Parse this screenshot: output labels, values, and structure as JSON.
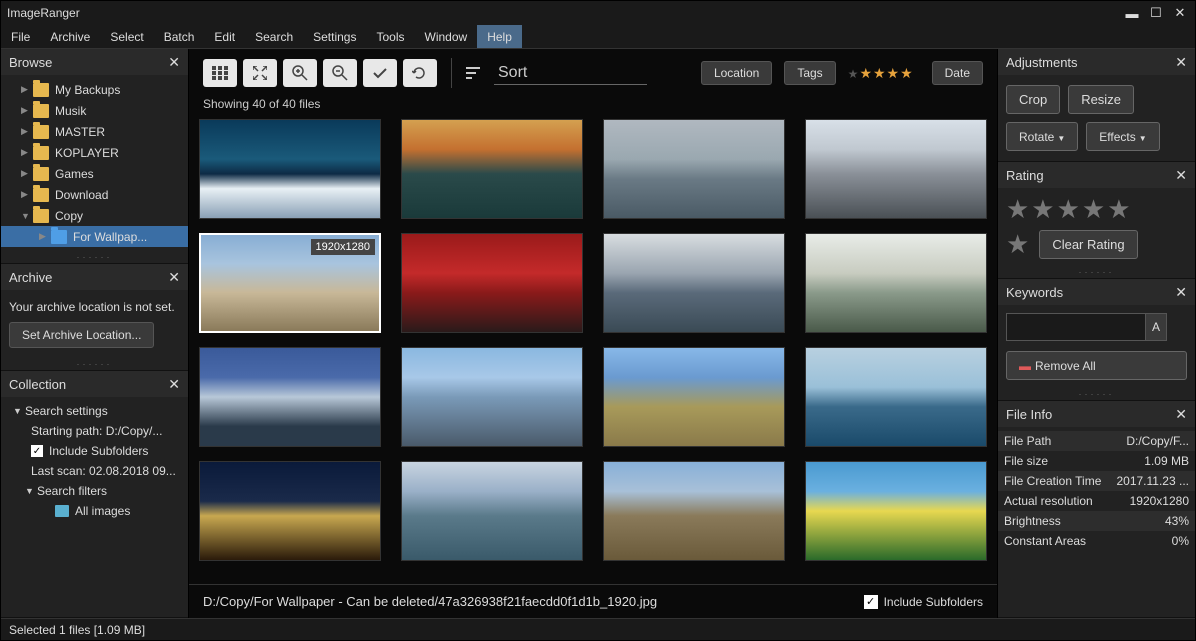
{
  "app_title": "ImageRanger",
  "menu": [
    "File",
    "Archive",
    "Select",
    "Batch",
    "Edit",
    "Search",
    "Settings",
    "Tools",
    "Window",
    "Help"
  ],
  "menu_hover_index": 9,
  "browse": {
    "title": "Browse",
    "items": [
      {
        "label": "My Backups",
        "expanded": false,
        "level": 1
      },
      {
        "label": "Musik",
        "expanded": false,
        "level": 1
      },
      {
        "label": "MASTER",
        "expanded": false,
        "level": 1
      },
      {
        "label": "KOPLAYER",
        "expanded": false,
        "level": 1
      },
      {
        "label": "Games",
        "expanded": false,
        "level": 1
      },
      {
        "label": "Download",
        "expanded": false,
        "level": 1
      },
      {
        "label": "Copy",
        "expanded": true,
        "level": 1
      },
      {
        "label": "For Wallpap...",
        "expanded": false,
        "level": 2,
        "selected": true
      }
    ]
  },
  "archive": {
    "title": "Archive",
    "msg": "Your archive location is not set.",
    "btn": "Set Archive Location..."
  },
  "collection": {
    "title": "Collection",
    "search_settings": "Search settings",
    "starting_path": "Starting path: D:/Copy/...",
    "include_subfolders": "Include Subfolders",
    "last_scan": "Last scan: 02.08.2018 09...",
    "search_filters": "Search filters",
    "all_images": "All images"
  },
  "toolbar": {
    "sort": "Sort",
    "location": "Location",
    "tags": "Tags",
    "date": "Date"
  },
  "showing": "Showing 40 of 40 files",
  "selected_badge": "1920x1280",
  "thumbs": [
    {
      "gradient": "linear-gradient(180deg,#0a3a5a 0%,#1a5a7a 40%,#0d2a45 55%,#e8f0f5 70%,#8aa0b5 100%)"
    },
    {
      "gradient": "linear-gradient(180deg,#d4a050 0%,#c47030 30%,#2a4a4a 55%,#1a3a3a 100%)"
    },
    {
      "gradient": "linear-gradient(180deg,#b0b8c0 0%,#9aa8b0 40%,#6a7a85 60%,#4a5a65 100%)"
    },
    {
      "gradient": "linear-gradient(180deg,#d8e0e8 0%,#c0c8d0 30%,#8a9098 55%,#4a5055 100%)"
    },
    {
      "gradient": "linear-gradient(180deg,#88aed4 0%,#a8c4de 30%,#c8b898 60%,#8a7a5a 100%)",
      "selected": true,
      "badge": true
    },
    {
      "gradient": "linear-gradient(180deg,#9a1a1a 0%,#c42a2a 40%,#8a1a1a 60%,#2a1a1a 100%)"
    },
    {
      "gradient": "linear-gradient(180deg,#d8dde0 0%,#9aa5b0 40%,#5a6a7a 60%,#3a4a55 100%)"
    },
    {
      "gradient": "linear-gradient(180deg,#e8ece8 0%,#c8ccc0 40%,#8a9a8a 60%,#4a5a4a 100%)"
    },
    {
      "gradient": "linear-gradient(180deg,#3a5a9a 0%,#4a6aaa 30%,#b8c8d8 50%,#2a3a4a 80%)"
    },
    {
      "gradient": "linear-gradient(180deg,#8ab8e0 0%,#a8c8e8 30%,#7a9ab8 50%,#4a5a6a 100%)"
    },
    {
      "gradient": "linear-gradient(180deg,#88b8e8 0%,#6a9ad0 30%,#a89a5a 60%,#8a7a4a 100%)"
    },
    {
      "gradient": "linear-gradient(180deg,#b8d0e0 0%,#9ac0d8 40%,#3a6a8a 60%,#1a4a6a 100%)"
    },
    {
      "gradient": "linear-gradient(180deg,#0a1a3a 0%,#1a2a4a 40%,#c8a850 55%,#2a1a0a 100%)"
    },
    {
      "gradient": "linear-gradient(180deg,#c8d4e0 0%,#9ab0c8 30%,#5a7a8a 55%,#3a5a6a 100%)"
    },
    {
      "gradient": "linear-gradient(180deg,#88b0d8 0%,#a8c0d8 30%,#8a7a5a 55%,#6a5a3a 100%)"
    },
    {
      "gradient": "linear-gradient(180deg,#4a9ad0 0%,#6ab0e0 30%,#e8d850 50%,#2a6a2a 100%)"
    }
  ],
  "path": "D:/Copy/For Wallpaper - Can be deleted/47a326938f21faecdd0f1d1b_1920.jpg",
  "include_subfolders_main": "Include Subfolders",
  "adjustments": {
    "title": "Adjustments",
    "crop": "Crop",
    "resize": "Resize",
    "rotate": "Rotate",
    "effects": "Effects"
  },
  "rating": {
    "title": "Rating",
    "clear": "Clear Rating"
  },
  "keywords": {
    "title": "Keywords",
    "add": "A",
    "remove": "Remove All"
  },
  "fileinfo": {
    "title": "File Info",
    "rows": [
      {
        "k": "File Path",
        "v": "D:/Copy/F..."
      },
      {
        "k": "File size",
        "v": "1.09 MB"
      },
      {
        "k": "File Creation Time",
        "v": "2017.11.23 ..."
      },
      {
        "k": "Actual resolution",
        "v": "1920x1280"
      },
      {
        "k": "Brightness",
        "v": "43%"
      },
      {
        "k": "Constant Areas",
        "v": "0%"
      }
    ]
  },
  "status": "Selected 1 files [1.09 MB]"
}
